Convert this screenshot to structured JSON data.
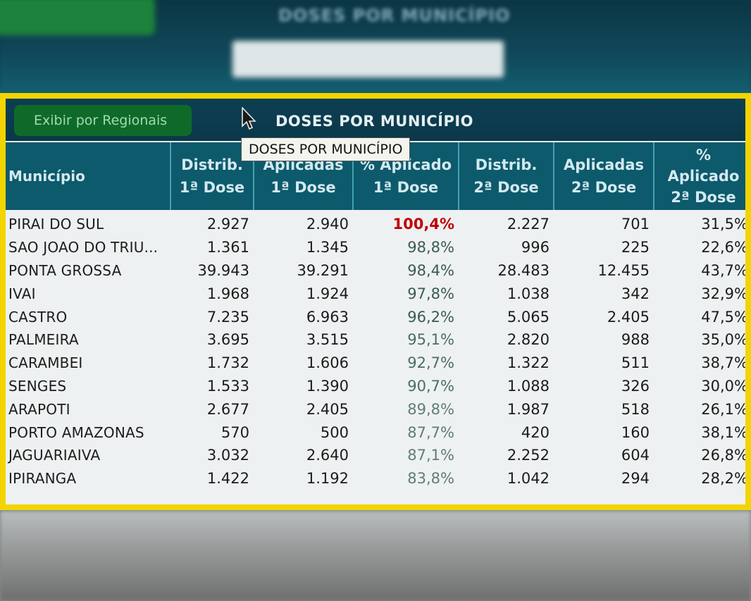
{
  "background": {
    "blur_button": "Exibir por Regionais",
    "blur_title": "DOSES POR MUNICÍPIO"
  },
  "toolbar": {
    "regionais_button": "Exibir por Regionais",
    "title": "DOSES POR MUNICÍPIO",
    "tooltip": "DOSES POR MUNICÍPIO"
  },
  "table": {
    "headers": [
      {
        "line1": "Município",
        "line2": ""
      },
      {
        "line1": "Distrib.",
        "line2": "1ª Dose"
      },
      {
        "line1": "Aplicadas",
        "line2": "1ª Dose"
      },
      {
        "line1": "% Aplicado",
        "line2": "1ª Dose"
      },
      {
        "line1": "Distrib.",
        "line2": "2ª Dose"
      },
      {
        "line1": "Aplicadas",
        "line2": "2ª Dose"
      },
      {
        "line1": "%",
        "line2": "Aplicado",
        "line3": "2ª Dose"
      }
    ],
    "rows": [
      {
        "municipio": "PIRAI DO SUL",
        "distrib1": "2.927",
        "aplic1": "2.940",
        "pct1": "100,4%",
        "distrib2": "2.227",
        "aplic2": "701",
        "pct2": "31,5%"
      },
      {
        "municipio": "SAO JOAO DO TRIU...",
        "distrib1": "1.361",
        "aplic1": "1.345",
        "pct1": "98,8%",
        "distrib2": "996",
        "aplic2": "225",
        "pct2": "22,6%"
      },
      {
        "municipio": "PONTA GROSSA",
        "distrib1": "39.943",
        "aplic1": "39.291",
        "pct1": "98,4%",
        "distrib2": "28.483",
        "aplic2": "12.455",
        "pct2": "43,7%"
      },
      {
        "municipio": "IVAI",
        "distrib1": "1.968",
        "aplic1": "1.924",
        "pct1": "97,8%",
        "distrib2": "1.038",
        "aplic2": "342",
        "pct2": "32,9%"
      },
      {
        "municipio": "CASTRO",
        "distrib1": "7.235",
        "aplic1": "6.963",
        "pct1": "96,2%",
        "distrib2": "5.065",
        "aplic2": "2.405",
        "pct2": "47,5%"
      },
      {
        "municipio": "PALMEIRA",
        "distrib1": "3.695",
        "aplic1": "3.515",
        "pct1": "95,1%",
        "distrib2": "2.820",
        "aplic2": "988",
        "pct2": "35,0%"
      },
      {
        "municipio": "CARAMBEI",
        "distrib1": "1.732",
        "aplic1": "1.606",
        "pct1": "92,7%",
        "distrib2": "1.322",
        "aplic2": "511",
        "pct2": "38,7%"
      },
      {
        "municipio": "SENGES",
        "distrib1": "1.533",
        "aplic1": "1.390",
        "pct1": "90,7%",
        "distrib2": "1.088",
        "aplic2": "326",
        "pct2": "30,0%"
      },
      {
        "municipio": "ARAPOTI",
        "distrib1": "2.677",
        "aplic1": "2.405",
        "pct1": "89,8%",
        "distrib2": "1.987",
        "aplic2": "518",
        "pct2": "26,1%"
      },
      {
        "municipio": "PORTO AMAZONAS",
        "distrib1": "570",
        "aplic1": "500",
        "pct1": "87,7%",
        "distrib2": "420",
        "aplic2": "160",
        "pct2": "38,1%"
      },
      {
        "municipio": "JAGUARIAIVA",
        "distrib1": "3.032",
        "aplic1": "2.640",
        "pct1": "87,1%",
        "distrib2": "2.252",
        "aplic2": "604",
        "pct2": "26,8%"
      },
      {
        "municipio": "IPIRANGA",
        "distrib1": "1.422",
        "aplic1": "1.192",
        "pct1": "83,8%",
        "distrib2": "1.042",
        "aplic2": "294",
        "pct2": "28,2%"
      }
    ]
  },
  "colors": {
    "frame_border": "#f1d400",
    "header_bg": "#0c5a6c",
    "highlight_pct": "#c00000",
    "button_green": "#0f6a2a"
  },
  "icons": {
    "cursor": "mouse-pointer-icon"
  }
}
